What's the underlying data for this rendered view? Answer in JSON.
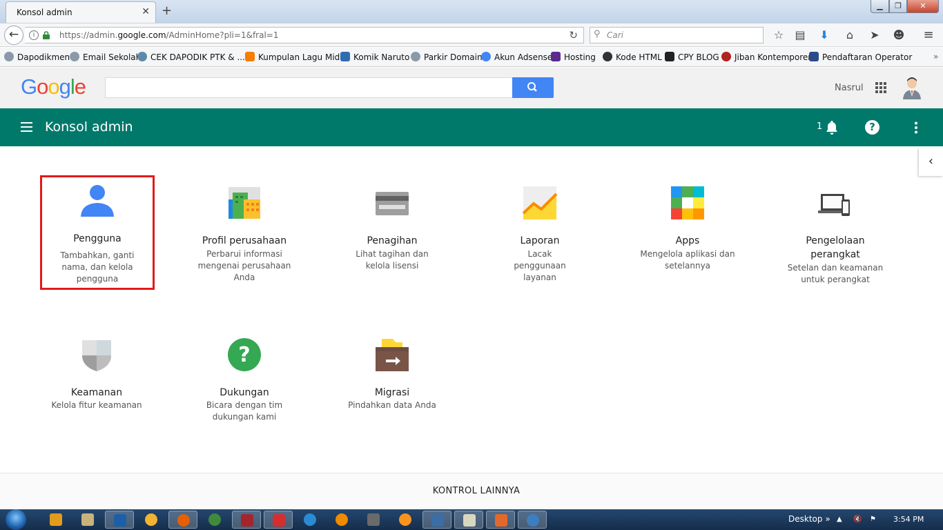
{
  "browser": {
    "tab_title": "Konsol admin",
    "url_prefix": "https://admin.",
    "url_domain": "google.com",
    "url_path": "/AdminHome?pli=1&fral=1",
    "search_placeholder": "Cari",
    "bookmarks": [
      "Dapodikmen",
      "Email Sekolah",
      "CEK DAPODIK PTK & ...",
      "Kumpulan Lagu Midi",
      "Komik Naruto",
      "Parkir Domain",
      "Akun Adsense",
      "Hosting",
      "Kode HTML",
      "CPY BLOG",
      "Jiban Kontemporer",
      "Pendaftaran Operator"
    ]
  },
  "google_header": {
    "logo": "Google",
    "user_name": "Nasrul"
  },
  "appbar": {
    "title": "Konsol admin",
    "notification_count": "1"
  },
  "cards": [
    {
      "title": "Pengguna",
      "description": "Tambahkan, ganti nama, dan kelola pengguna",
      "icon": "user-icon"
    },
    {
      "title": "Profil perusahaan",
      "description": "Perbarui informasi mengenai perusahaan Anda",
      "icon": "company-profile-icon"
    },
    {
      "title": "Penagihan",
      "description": "Lihat tagihan dan kelola lisensi",
      "icon": "billing-card-icon"
    },
    {
      "title": "Laporan",
      "description": "Lacak penggunaan layanan",
      "icon": "report-chart-icon"
    },
    {
      "title": "Apps",
      "description": "Mengelola aplikasi dan setelannya",
      "icon": "apps-grid-icon"
    },
    {
      "title": "Pengelolaan perangkat",
      "description": "Setelan dan keamanan untuk perangkat",
      "icon": "devices-icon"
    },
    {
      "title": "Keamanan",
      "description": "Kelola fitur keamanan",
      "icon": "shield-icon"
    },
    {
      "title": "Dukungan",
      "description": "Bicara dengan tim dukungan kami",
      "icon": "help-circle-icon"
    },
    {
      "title": "Migrasi",
      "description": "Pindahkan data Anda",
      "icon": "migration-box-icon"
    }
  ],
  "footer": {
    "more_controls": "KONTROL LAINNYA"
  },
  "taskbar": {
    "desktop_label": "Desktop",
    "chevron": "»",
    "time": "3:54 PM"
  },
  "colors": {
    "appbar": "#00796b",
    "selection_border": "#e11b1b",
    "search_button": "#4285f4"
  }
}
